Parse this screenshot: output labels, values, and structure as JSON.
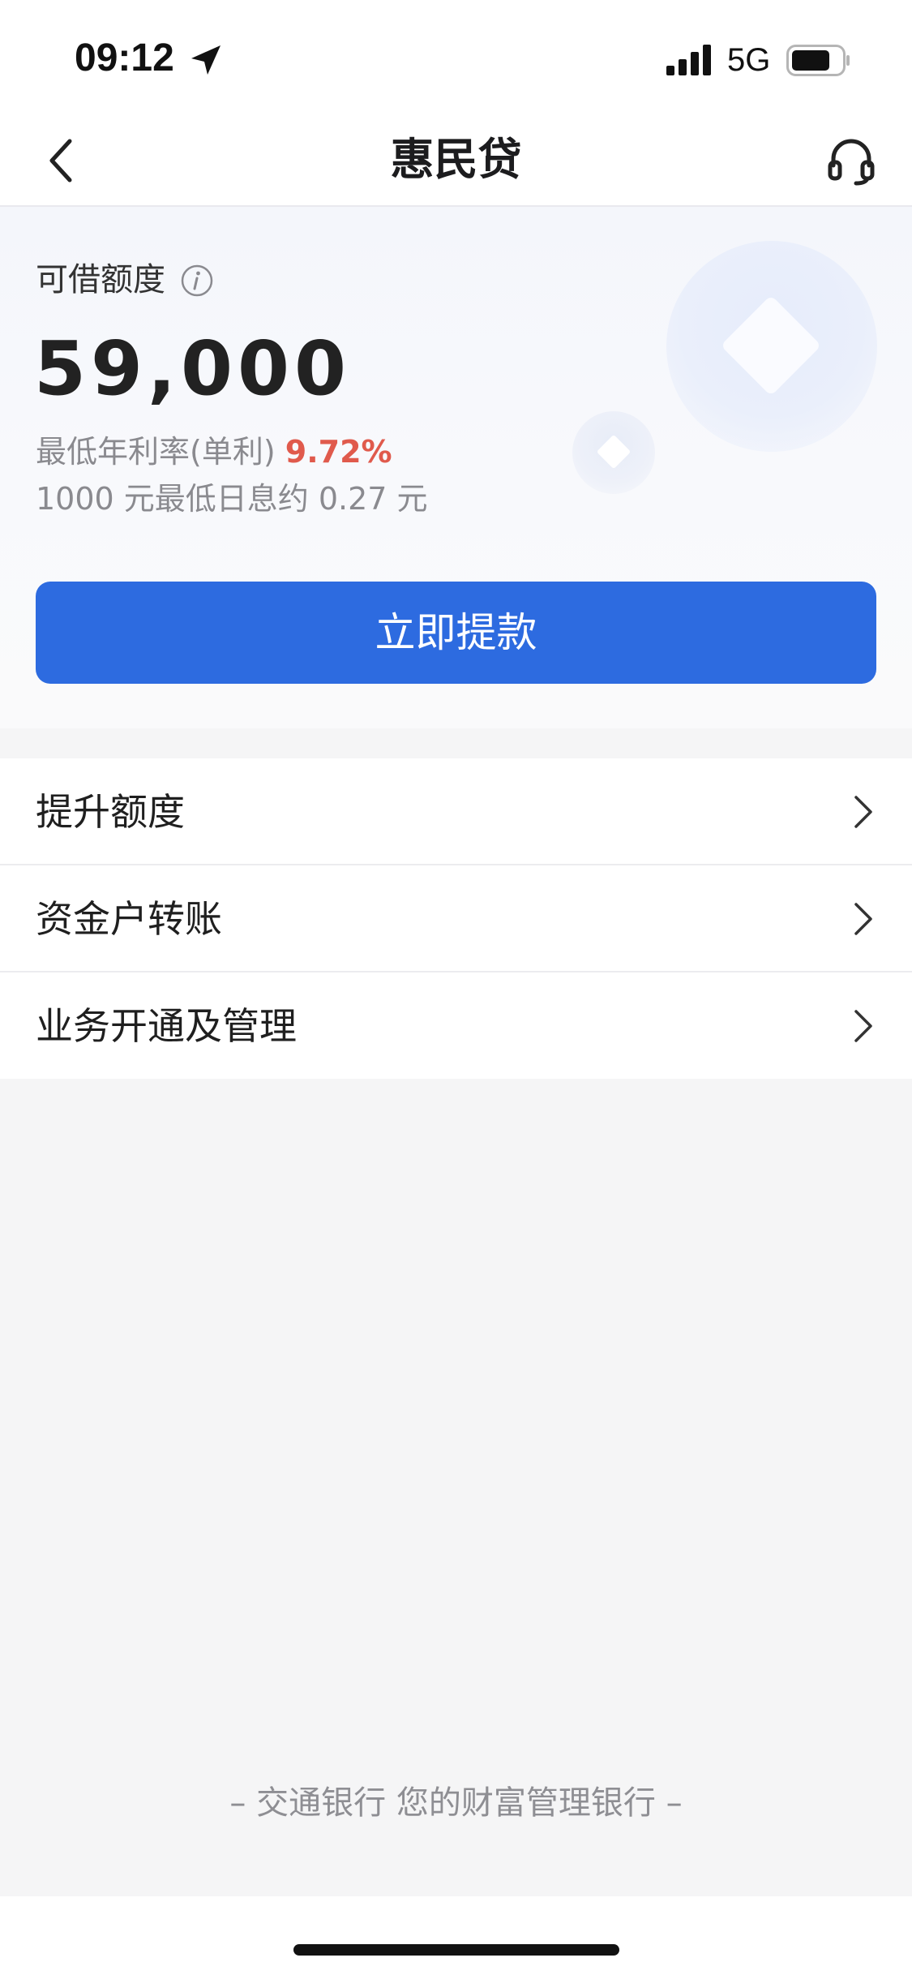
{
  "status_bar": {
    "time": "09:12",
    "network": "5G",
    "icons": [
      "location-arrow-icon",
      "cellular-signal-icon",
      "battery-icon"
    ]
  },
  "nav": {
    "title": "惠民贷",
    "back_icon": "chevron-left-icon",
    "service_icon": "headset-icon"
  },
  "credit": {
    "label": "可借额度",
    "info_icon": "info-icon",
    "amount": "59,000",
    "rate_prefix": "最低年利率(单利)",
    "rate_value": "9.72%",
    "interest_note": "1000 元最低日息约 0.27 元",
    "withdraw_label": "立即提款"
  },
  "menu": {
    "items": [
      {
        "label": "提升额度"
      },
      {
        "label": "资金户转账"
      },
      {
        "label": "业务开通及管理"
      }
    ]
  },
  "footer": {
    "slogan": "– 交通银行 您的财富管理银行 –"
  },
  "colors": {
    "primary": "#2d6be0",
    "rate_highlight": "#e05a4c",
    "page_background": "#f5f5f6"
  }
}
